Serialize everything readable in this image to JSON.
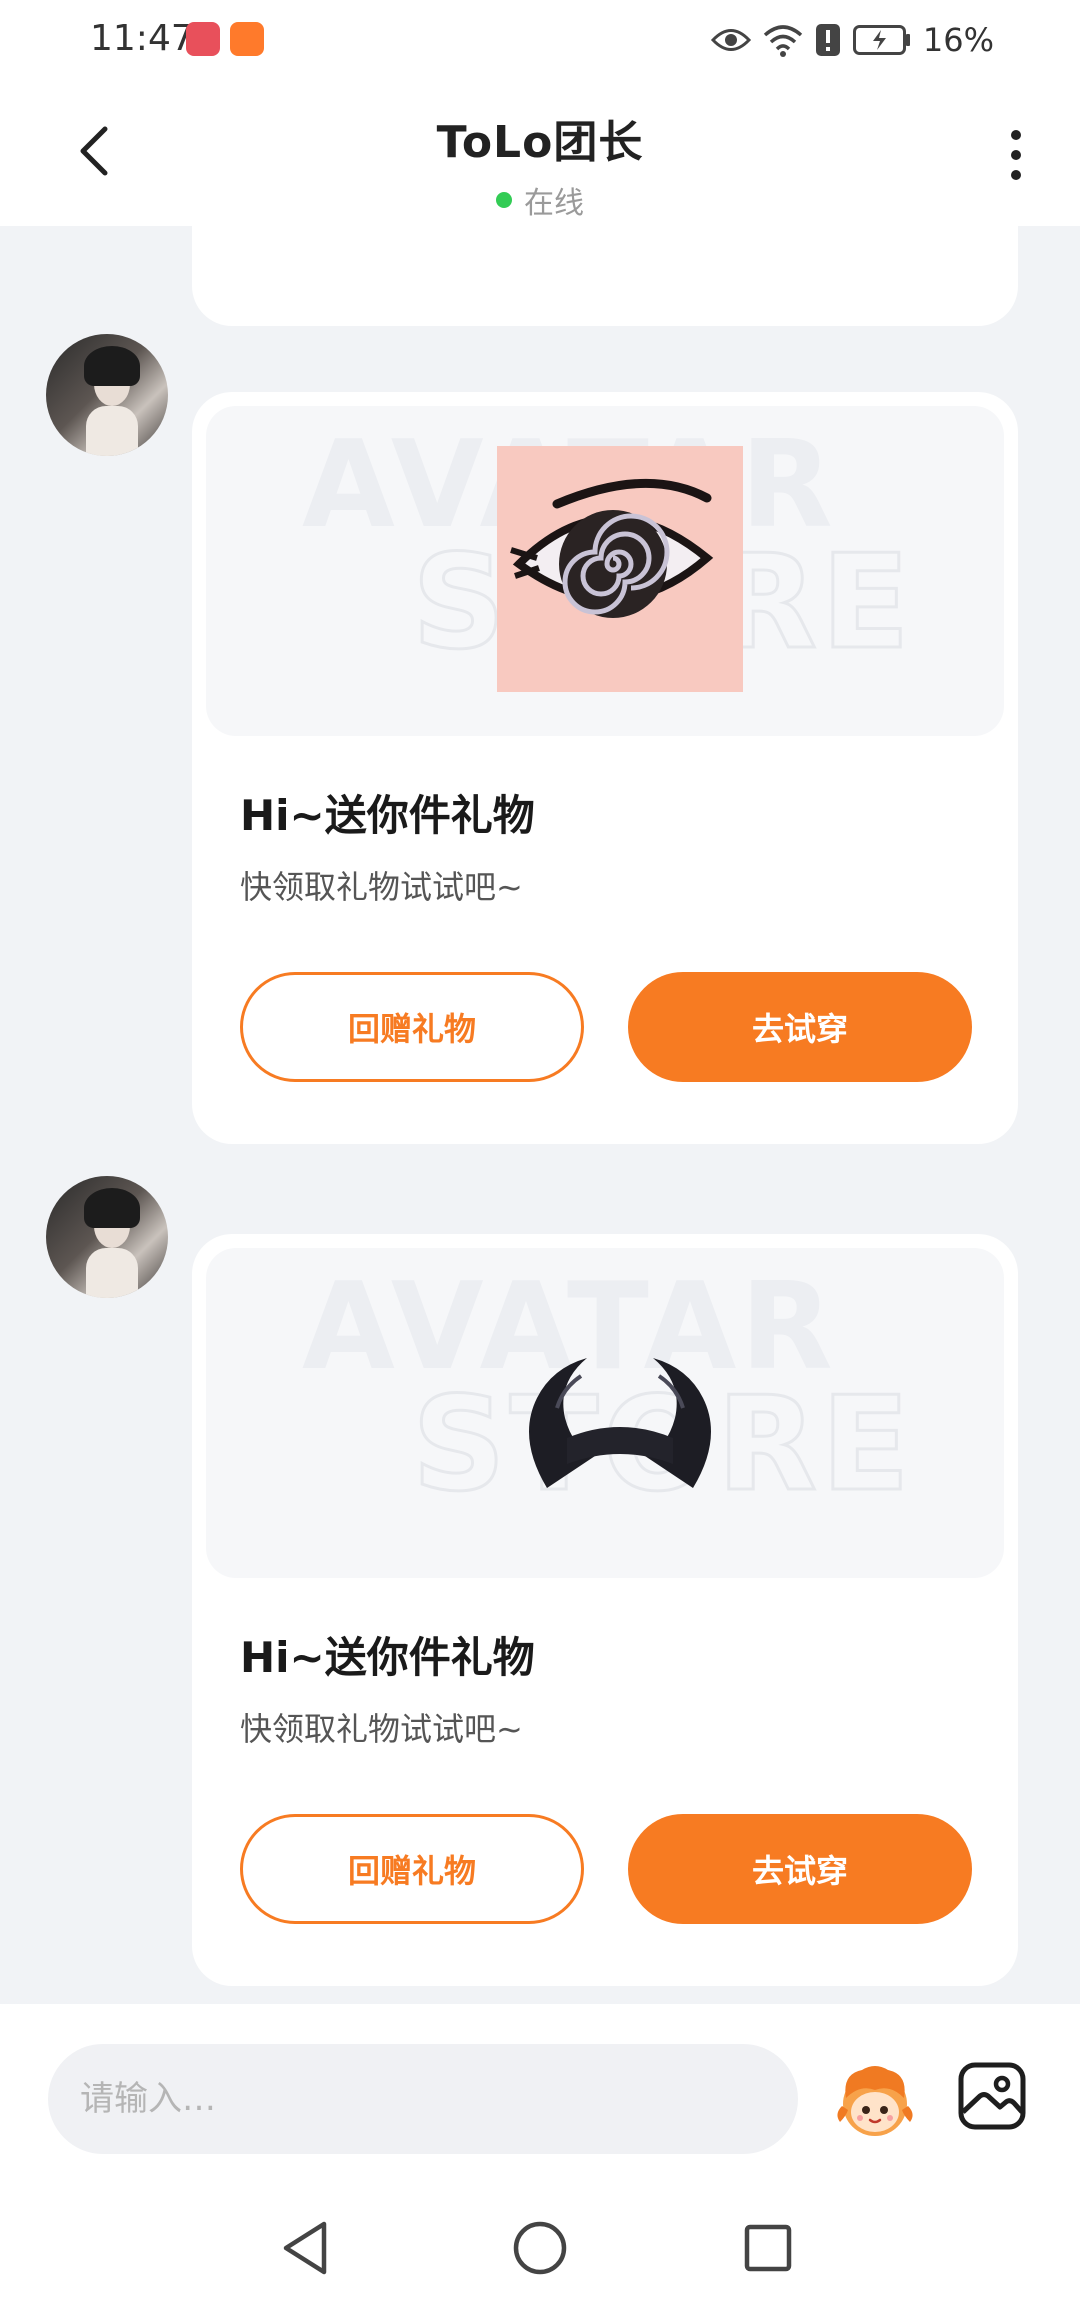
{
  "status_bar": {
    "time": "11:47",
    "battery_percent": "16%",
    "icons": [
      "huawei-app-icon",
      "video-app-icon",
      "eye-icon",
      "wifi-icon",
      "alert-icon",
      "battery-charging-icon"
    ]
  },
  "header": {
    "title": "ToLo团长",
    "status": "在线",
    "status_color": "#33cc55"
  },
  "accent_color": "#f77b22",
  "messages": [
    {
      "gift_icon": "spiral-eye-sticker",
      "title": "Hi~送你件礼物",
      "subtitle": "快领取礼物试试吧~",
      "secondary_label": "回赠礼物",
      "primary_label": "去试穿"
    },
    {
      "gift_icon": "black-horns-headband",
      "title": "Hi~送你件礼物",
      "subtitle": "快领取礼物试试吧~",
      "secondary_label": "回赠礼物",
      "primary_label": "去试穿"
    }
  ],
  "input": {
    "placeholder": "请输入…"
  },
  "nav": {
    "icons": [
      "back-triangle-icon",
      "home-circle-icon",
      "recent-square-icon"
    ]
  }
}
